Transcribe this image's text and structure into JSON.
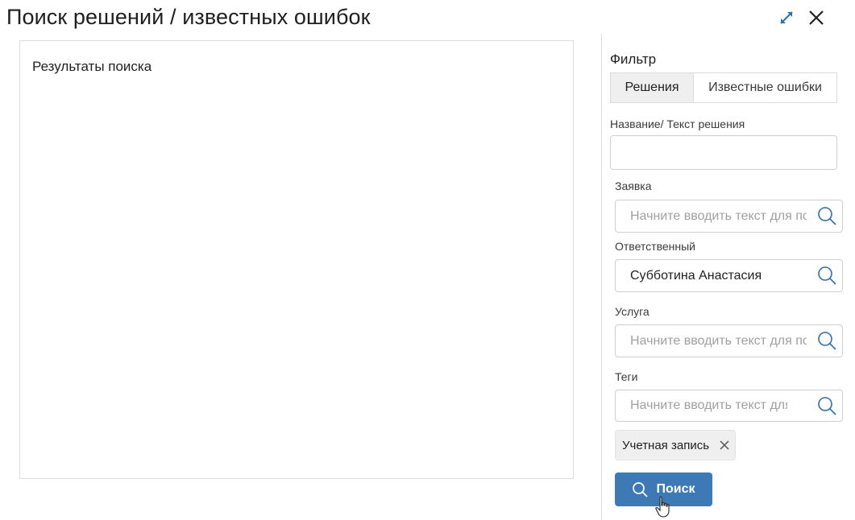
{
  "header": {
    "title": "Поиск решений / известных ошибок",
    "expand_icon": "expand-diagonal-icon",
    "close_icon": "close-icon"
  },
  "results": {
    "title": "Результаты поиска"
  },
  "filter": {
    "title": "Фильтр",
    "tabs": [
      {
        "label": "Решения",
        "active": true
      },
      {
        "label": "Известные ошибки",
        "active": false
      }
    ],
    "fields": {
      "name_text": {
        "label": "Название/ Текст решения",
        "value": ""
      },
      "request": {
        "label": "Заявка",
        "placeholder": "Начните вводить текст для поиска"
      },
      "responsible": {
        "label": "Ответственный",
        "value": "Субботина Анастасия"
      },
      "service": {
        "label": "Услуга",
        "placeholder": "Начните вводить текст для поиска"
      },
      "tags": {
        "label": "Теги",
        "placeholder": "Начните вводить текст для поиска"
      }
    },
    "selected_tags": [
      {
        "label": "Учетная запись"
      }
    ],
    "search_button": {
      "label": "Поиск",
      "icon": "search-icon"
    }
  },
  "colors": {
    "accent": "#3d7ab5",
    "icon_blue": "#2f6fad",
    "tab_active_bg": "#efefef",
    "border": "#dcdcdc"
  }
}
